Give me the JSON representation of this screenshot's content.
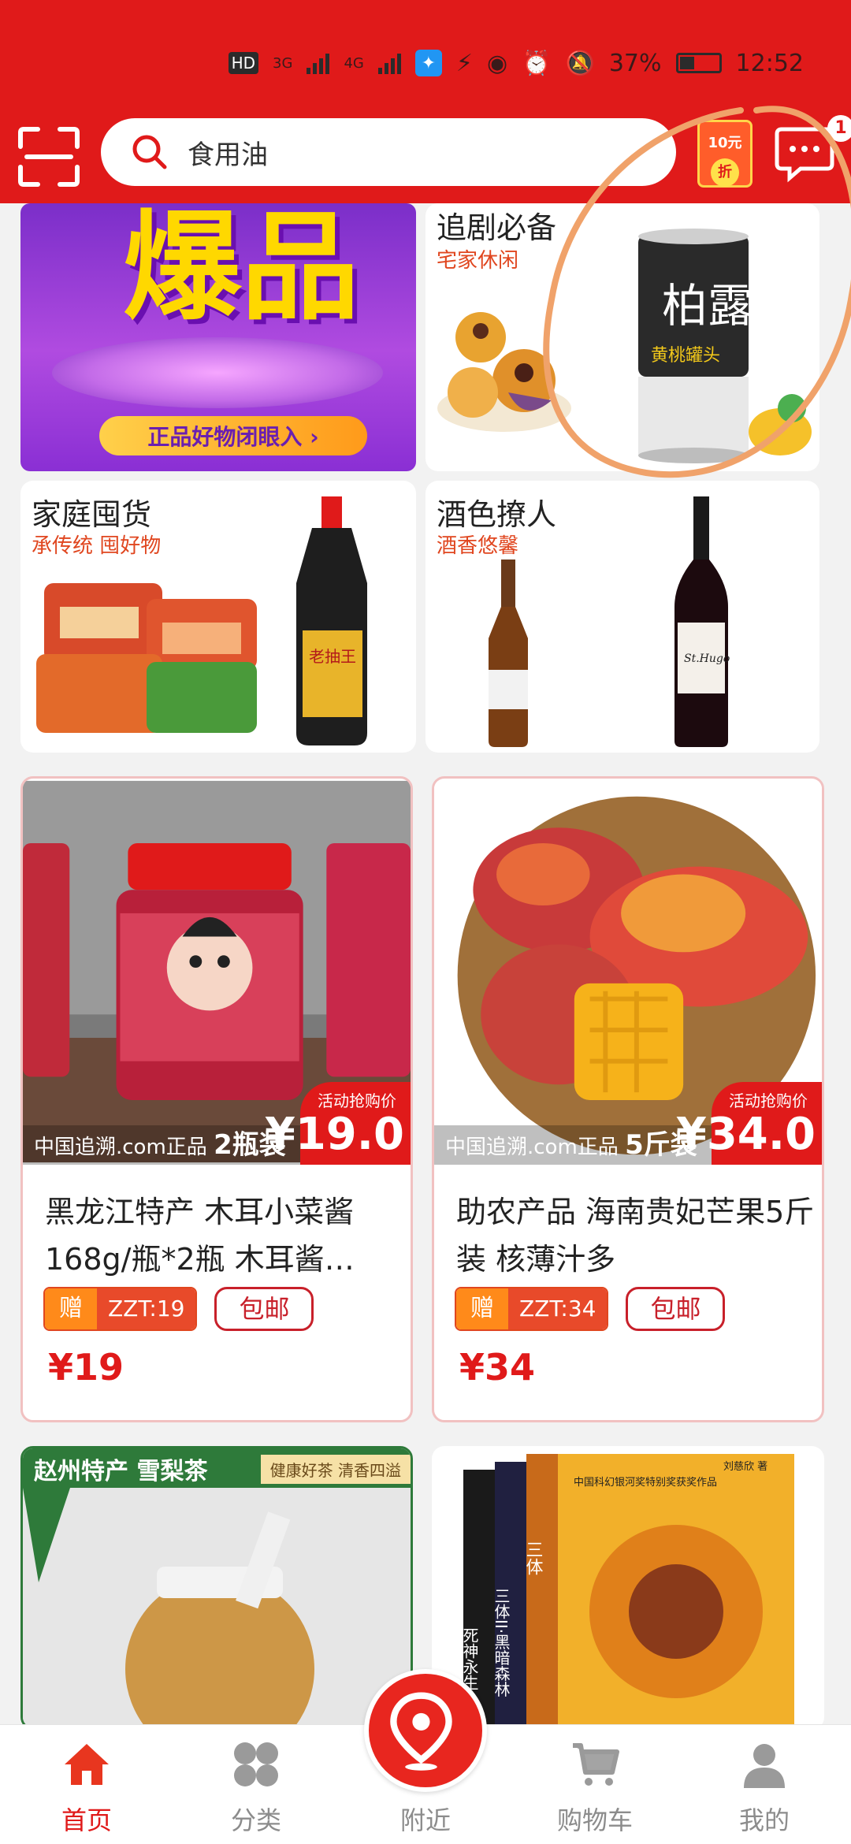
{
  "status_bar": {
    "network": "HD",
    "signal_1": "3G",
    "signal_2": "4G",
    "battery": "37%",
    "time": "12:52"
  },
  "header": {
    "search_placeholder": "食用油",
    "coupon_top": "10元",
    "coupon_bottom": "折",
    "message_badge": "1"
  },
  "banner_left": {
    "headline": "爆品",
    "tagline": "正品好物闭眼入 ›"
  },
  "panels": [
    {
      "title": "追剧必备",
      "subtitle": "宅家休闲"
    },
    {
      "title": "家庭囤货",
      "subtitle": "承传统 囤好物"
    },
    {
      "title": "酒色撩人",
      "subtitle": "酒香悠馨"
    }
  ],
  "product_labels": {
    "canned_brand": "柏露",
    "canned_sub": "黄桃罐头",
    "soy_brand": "老抽王",
    "wine_label": "St.Hugo"
  },
  "products": [
    {
      "promo_label": "活动抢购价",
      "promo_price": "¥19.0",
      "watermark": "中国追溯.com正品",
      "watermark_2": "2瓶装",
      "name": "黑龙江特产 木耳小菜酱168g/瓶*2瓶 木耳酱…",
      "gift": "赠",
      "zzt": "ZZT:19",
      "shipping": "包邮",
      "price": "¥19"
    },
    {
      "promo_label": "活动抢购价",
      "promo_price": "¥34.0",
      "watermark": "中国追溯.com正品",
      "watermark_2": "5斤装",
      "name": "助农产品 海南贵妃芒果5斤装 核薄汁多",
      "gift": "赠",
      "zzt": "ZZT:34",
      "shipping": "包邮",
      "price": "¥34"
    }
  ],
  "lower_cards": {
    "tea_title": "赵州特产 雪梨茶",
    "tea_tag": "健康好茶 清香四溢",
    "book_title": "三体",
    "book_sub": "三体II·黑暗森林",
    "book_sub2": "死神永生",
    "book_award": "中国科幻银河奖特别奖获奖作品",
    "book_author": "刘慈欣 著"
  },
  "nav": {
    "items": [
      {
        "label": "首页",
        "icon": "home-icon"
      },
      {
        "label": "分类",
        "icon": "category-icon"
      },
      {
        "label": "附近",
        "icon": "location-icon"
      },
      {
        "label": "购物车",
        "icon": "cart-icon"
      },
      {
        "label": "我的",
        "icon": "user-icon"
      }
    ]
  },
  "colors": {
    "brand": "#e01a1a",
    "accent_orange": "#ff8a1a",
    "annotation": "#f0a26a"
  }
}
